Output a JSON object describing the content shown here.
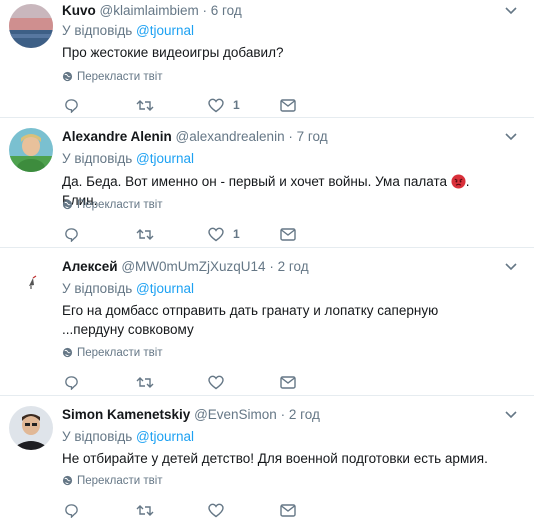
{
  "colors": {
    "link": "#1da1f2",
    "muted": "#657786",
    "text": "#14171a",
    "divider": "#e6ecf0"
  },
  "tweets": [
    {
      "name": "Kuvo",
      "handle": "@klaimlaimbiem",
      "dot": "·",
      "time": "6 год",
      "reply_prefix": "У відповідь",
      "reply_to": "@tjournal",
      "text": "Про жестокие видеоигры добавил?",
      "translate": "Перекласти твіт",
      "likes": "1",
      "icons": [
        "reply-icon",
        "retweet-icon",
        "like-icon",
        "message-icon",
        "chevron-down-icon",
        "globe-icon"
      ]
    },
    {
      "name": "Alexandre Alenin",
      "handle": "@alexandrealenin",
      "dot": "·",
      "time": "7 год",
      "reply_prefix": "У відповідь",
      "reply_to": "@tjournal",
      "text_before_emoji": "Да. Беда. Вот именно он - первый и хочет войны. Ума палата",
      "text_after_emoji": ". Блин.",
      "emoji": "angry-face-emoji",
      "translate": "Перекласти твіт",
      "likes": "1"
    },
    {
      "name": "Алексей",
      "handle": "@MW0mUmZjXuzqU14",
      "dot": "·",
      "time": "2 год",
      "reply_prefix": "У відповідь",
      "reply_to": "@tjournal",
      "text": "Его на домбасс отправить дать гранату и лопатку саперную ...пердуну совковому",
      "translate": "Перекласти твіт",
      "likes": ""
    },
    {
      "name": "Simon Kamenetskiy",
      "handle": "@EvenSimon",
      "dot": "·",
      "time": "2 год",
      "reply_prefix": "У відповідь",
      "reply_to": "@tjournal",
      "text": "Не отбирайте у детей детство! Для военной подготовки есть армия.",
      "translate": "Перекласти твіт",
      "likes": ""
    }
  ]
}
